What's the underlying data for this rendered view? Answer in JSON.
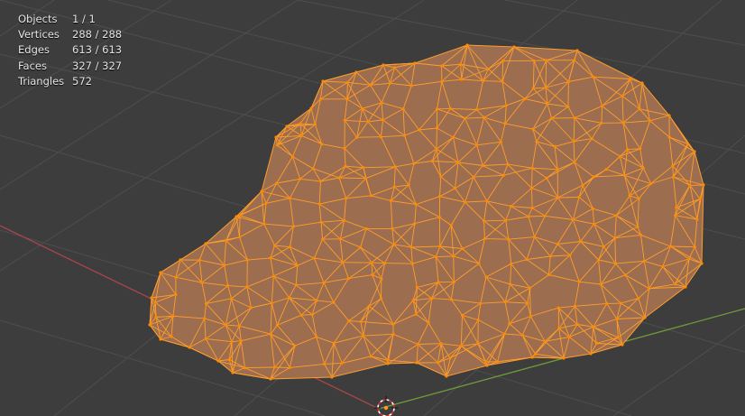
{
  "viewport": {
    "background_color": "#3d3d3d",
    "grid_color": "#4e4e4e",
    "x_axis_color": "#a8454b",
    "y_axis_color": "#6f9b3a",
    "mesh_fill_color": "#9c6e4f",
    "mesh_wire_color": "#ff9d2c",
    "mesh_vertex_color": "#ff8a00"
  },
  "stats": {
    "rows": [
      {
        "label": "Objects",
        "value": "1 / 1"
      },
      {
        "label": "Vertices",
        "value": "288 / 288"
      },
      {
        "label": "Edges",
        "value": "613 / 613"
      },
      {
        "label": "Faces",
        "value": "327 / 327"
      },
      {
        "label": "Triangles",
        "value": "572"
      }
    ]
  },
  "cursor": {
    "icon": "3d-cursor-icon"
  }
}
